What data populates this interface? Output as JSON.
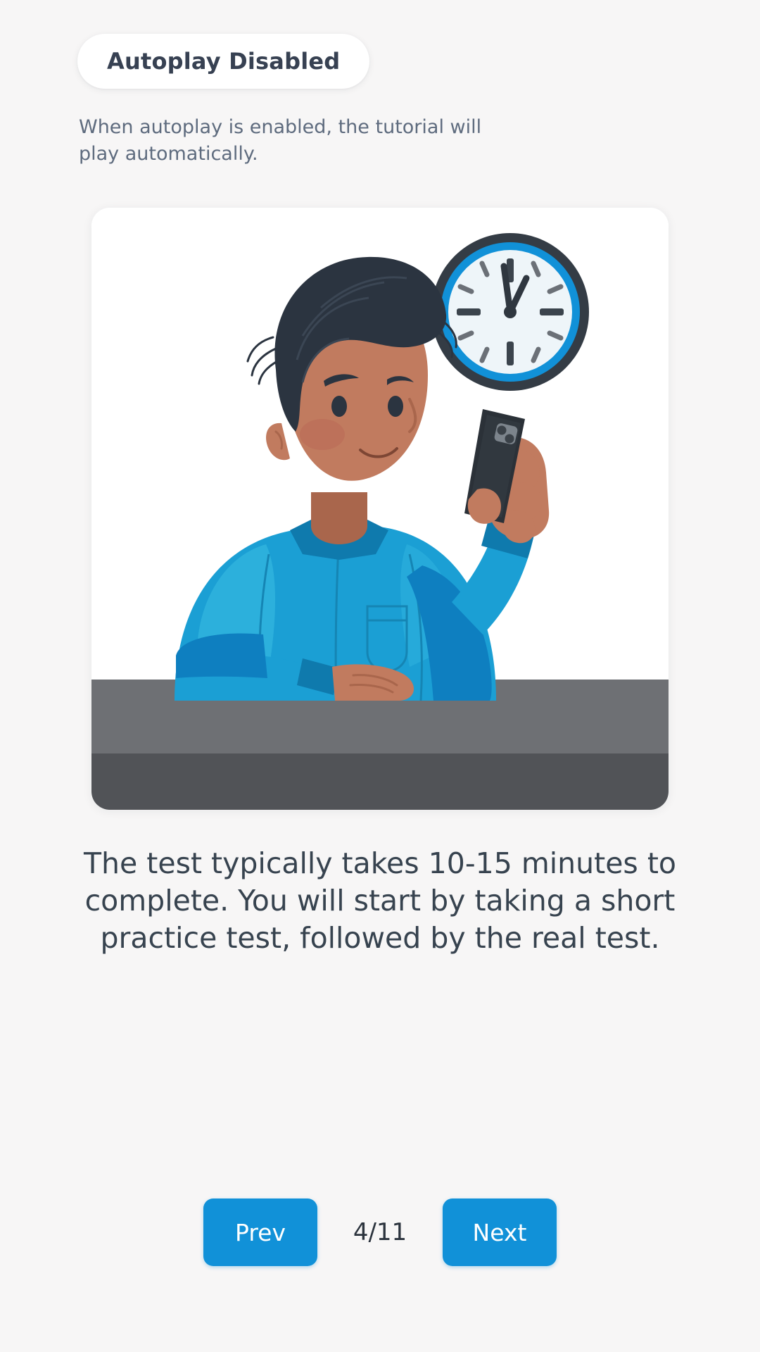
{
  "background_color": "#f7f6f6",
  "accent_color": "#1191d8",
  "autoplay": {
    "badge_label": "Autoplay Disabled",
    "description": "When autoplay is enabled, the tutorial will play automatically."
  },
  "illustration": {
    "name": "man-holding-phone-at-desk-with-wall-clock",
    "card_background": "#ffffff",
    "colors": {
      "shirt": "#1b9fd4",
      "shirt_dark": "#0f7aad",
      "shirt_highlight": "#2fb3dd",
      "skin": "#c17b5f",
      "skin_shadow": "#a9664c",
      "hair": "#2b3440",
      "desk_top": "#6e7074",
      "desk_edge": "#515357",
      "clock_ring": "#343c45",
      "clock_blue": "#1191d8",
      "clock_face": "#eef5f9",
      "phone": "#2b3138"
    },
    "clock_time": "12:02"
  },
  "caption": {
    "text": "The test typically takes 10-15 minutes to complete. You will start by taking a short practice test, followed by the real test."
  },
  "nav": {
    "prev_label": "Prev",
    "next_label": "Next",
    "counter": "4/11",
    "current_page": 4,
    "total_pages": 11
  }
}
